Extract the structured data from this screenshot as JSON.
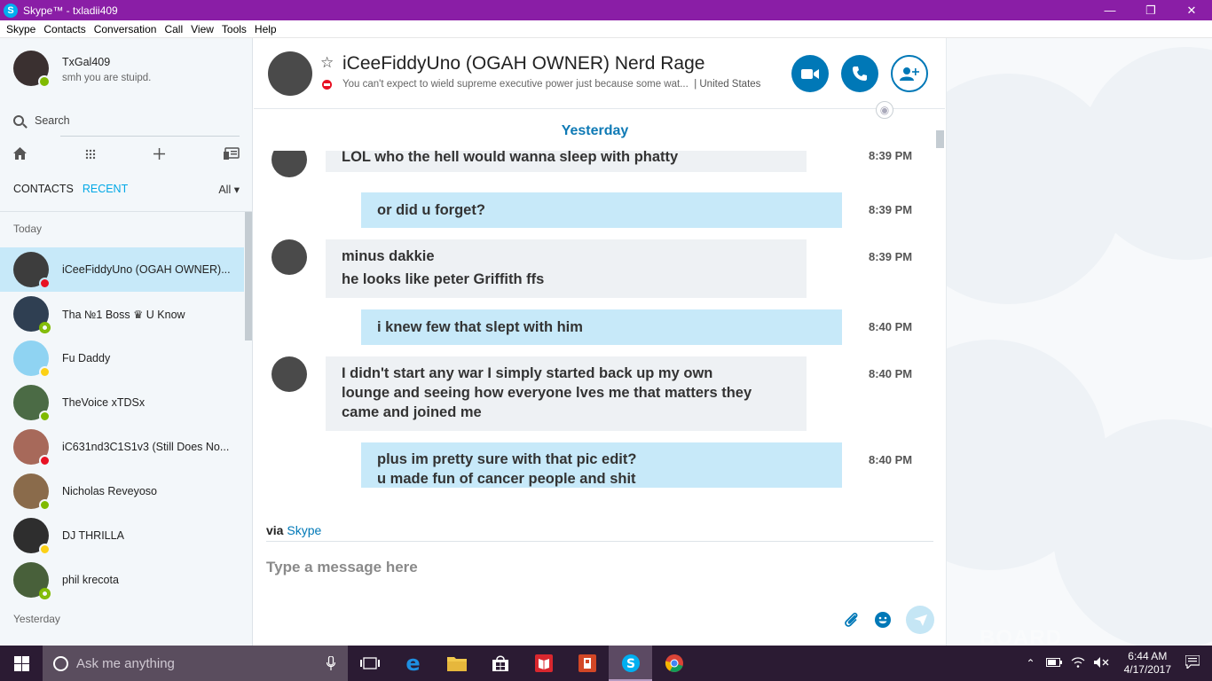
{
  "window": {
    "title": "Skype™ - txladii409",
    "logo": "S",
    "controls": [
      "—",
      "❐",
      "✕"
    ]
  },
  "menu": [
    "Skype",
    "Contacts",
    "Conversation",
    "Call",
    "View",
    "Tools",
    "Help"
  ],
  "profile": {
    "name": "TxGal409",
    "mood": "smh you are stuipd.",
    "status": "online"
  },
  "search": {
    "placeholder": "Search"
  },
  "tabs": {
    "contacts": "CONTACTS",
    "recent": "RECENT",
    "filter": "All"
  },
  "sections": {
    "today": "Today",
    "yesterday": "Yesterday"
  },
  "contacts": [
    {
      "name": "iCeeFiddyUno (OGAH OWNER)...",
      "status": "dnd",
      "selected": true,
      "color": "#3d3d3d"
    },
    {
      "name": "Tha №1 Boss ♛ U Know",
      "status": "offline",
      "color": "#2f3f52"
    },
    {
      "name": "Fu Daddy",
      "status": "away",
      "color": "#8fd3f2"
    },
    {
      "name": "TheVoice xTDSx",
      "status": "online",
      "color": "#4b6b45"
    },
    {
      "name": "iC631nd3C1S1v3 (Still Does No...",
      "status": "dnd",
      "color": "#a7695a"
    },
    {
      "name": "Nicholas Reveyoso",
      "status": "online",
      "color": "#8a6b4b"
    },
    {
      "name": "DJ THRILLA",
      "status": "away",
      "color": "#2e2e2e"
    },
    {
      "name": "phil krecota",
      "status": "offline",
      "color": "#48603a"
    }
  ],
  "conversation": {
    "name": "iCeeFiddyUno (OGAH OWNER) Nerd Rage",
    "star": "☆",
    "mood": "You can't expect to wield supreme executive power just because some wat...",
    "location": "| United States",
    "day": "Yesterday",
    "messages": [
      {
        "dir": "in",
        "lines": [
          "LOL who the hell would wanna sleep with phatty"
        ],
        "time": "8:39 PM"
      },
      {
        "dir": "out",
        "lines": [
          "or did u forget?"
        ],
        "time": "8:39 PM"
      },
      {
        "dir": "in",
        "lines": [
          "minus dakkie",
          "he looks like peter Griffith ffs"
        ],
        "time": "8:39 PM"
      },
      {
        "dir": "out",
        "lines": [
          "i knew few that slept with him"
        ],
        "time": "8:40 PM"
      },
      {
        "dir": "in",
        "lines": [
          "I didn't start any war I simply started back up my own",
          "lounge and seeing how everyone lves me that matters they",
          "came and joined me"
        ],
        "time": "8:40 PM"
      },
      {
        "dir": "out",
        "lines": [
          "plus im pretty sure with that pic edit?",
          "u made fun of cancer  people and shit"
        ],
        "time": "8:40 PM"
      }
    ],
    "via_label": "via",
    "via_link": "Skype",
    "composer_placeholder": "Type a message here"
  },
  "taskbar": {
    "search_placeholder": "Ask me anything",
    "apps": [
      "task-view",
      "edge",
      "file-explorer",
      "store",
      "pdf-reader",
      "office",
      "skype",
      "chrome"
    ],
    "time": "6:44 AM",
    "date": "4/17/2017"
  },
  "watermark": "BOARD",
  "colors": {
    "accent": "#0078b7",
    "titlebar": "#8a1ea6",
    "selected": "#c7e9f9"
  }
}
